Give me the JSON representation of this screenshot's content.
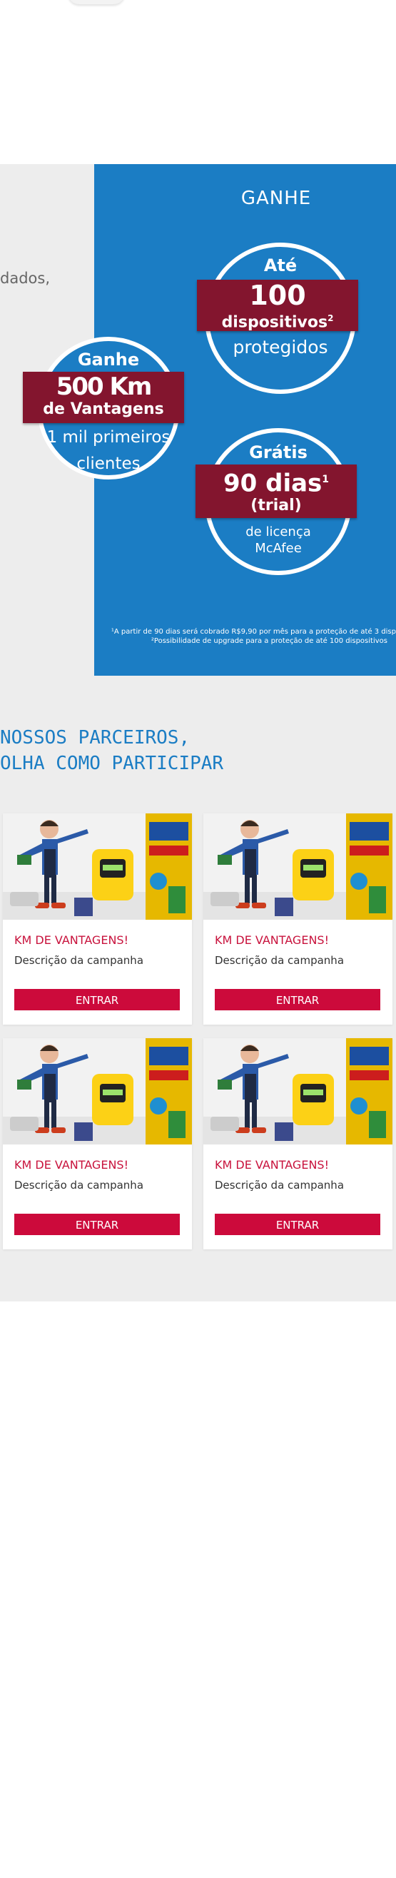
{
  "promo": {
    "side_text": "dados,",
    "blue_title": "GANHE",
    "badge_km": {
      "line1": "Ganhe",
      "line2": "500 Km",
      "line3": "de Vantagens",
      "line4": "1 mil primeiros",
      "line5": "clientes"
    },
    "badge_devices": {
      "line1": "Até",
      "line2": "100",
      "line3": "dispositivos",
      "sup": "2",
      "line4": "protegidos"
    },
    "badge_trial": {
      "line1": "Grátis",
      "line2": "90 dias",
      "sup": "1",
      "line3": "(trial)",
      "line4": "de licença",
      "line5": "McAfee"
    },
    "footnote1": "¹A partir de 90 dias será cobrado R$9,90 por mês para a proteção de até 3 disp",
    "footnote2": "²Possibilidade de upgrade para a proteção de até 100 dispositivos"
  },
  "partners": {
    "title_line1": "NOSSOS PARCEIROS,",
    "title_line2": "OLHA COMO PARTICIPAR",
    "cards": [
      {
        "title": "KM DE VANTAGENS!",
        "description": "Descrição da campanha",
        "button": "ENTRAR"
      },
      {
        "title": "KM DE VANTAGENS!",
        "description": "Descrição da campanha",
        "button": "ENTRAR"
      },
      {
        "title": "KM DE VANTAGENS!",
        "description": "Descrição da campanha",
        "button": "ENTRAR"
      },
      {
        "title": "KM DE VANTAGENS!",
        "description": "Descrição da campanha",
        "button": "ENTRAR"
      }
    ]
  },
  "colors": {
    "blue": "#1b7dc4",
    "ribbon": "#83152e",
    "button": "#cc0a3b",
    "gray_bg": "#ededed"
  },
  "icons": [
    "mascot-illustration",
    "fuel-pump-illustration"
  ]
}
